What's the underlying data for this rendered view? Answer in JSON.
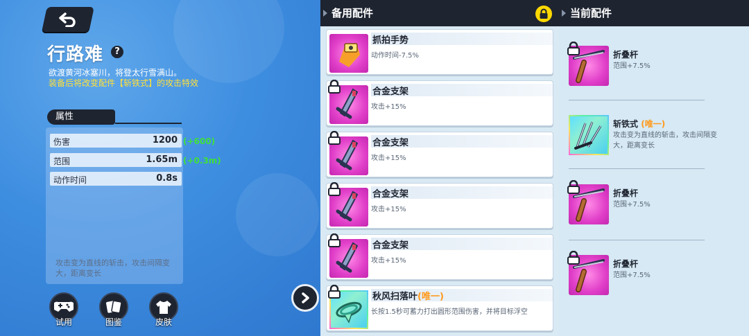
{
  "left": {
    "title": "行路难",
    "help": "?",
    "desc_line1": "欲渡黄河冰塞川，将登太行雪满山。",
    "desc_line2": "装备后将改变配件【斩铁式】的攻击特效",
    "attr_tab": "属性",
    "stats": [
      {
        "label": "伤害",
        "value": "1200",
        "bonus": "(+600)"
      },
      {
        "label": "范围",
        "value": "1.65m",
        "bonus": "(+0.3m)"
      },
      {
        "label": "动作时间",
        "value": "0.8s",
        "bonus": ""
      }
    ],
    "stat_desc": "攻击变为直线的斩击，攻击间隔变大，距离变长",
    "buttons": [
      {
        "label": "试用",
        "icon": "gamepad-icon"
      },
      {
        "label": "图鉴",
        "icon": "cards-icon"
      },
      {
        "label": "皮肤",
        "icon": "shirt-icon"
      }
    ]
  },
  "middle": {
    "header": "备用配件",
    "cards": [
      {
        "name": "抓拍手势",
        "unique": "",
        "effect": "动作时间-7.5%",
        "icon": "camera-hand-icon"
      },
      {
        "name": "合金支架",
        "unique": "",
        "effect": "攻击+15%",
        "icon": "alloy-stand-icon"
      },
      {
        "name": "合金支架",
        "unique": "",
        "effect": "攻击+15%",
        "icon": "alloy-stand-icon"
      },
      {
        "name": "合金支架",
        "unique": "",
        "effect": "攻击+15%",
        "icon": "alloy-stand-icon"
      },
      {
        "name": "合金支架",
        "unique": "",
        "effect": "攻击+15%",
        "icon": "alloy-stand-icon"
      },
      {
        "name": "秋风扫落叶",
        "unique": "(唯一)",
        "effect": "长按1.5秒可蓄力打出圆形范围伤害，并将目标浮空",
        "icon": "whirlwind-icon"
      }
    ]
  },
  "right": {
    "header": "当前配件",
    "items": [
      {
        "name": "折叠杆",
        "unique": "",
        "effect": "范围+7.5%",
        "icon": "folding-pole-icon"
      },
      {
        "name": "斩铁式",
        "unique": "(唯一)",
        "effect": "攻击变为直线的斩击，攻击间隔变大，距离变长",
        "icon": "iron-slash-icon"
      },
      {
        "name": "折叠杆",
        "unique": "",
        "effect": "范围+7.5%",
        "icon": "folding-pole-icon"
      },
      {
        "name": "折叠杆",
        "unique": "",
        "effect": "范围+7.5%",
        "icon": "folding-pole-icon"
      }
    ]
  },
  "colors": {
    "accent_yellow": "#ffd800",
    "bonus_green": "#3fe03a",
    "unique_orange": "#ff9a1a",
    "panel_dark": "#1e2430"
  }
}
